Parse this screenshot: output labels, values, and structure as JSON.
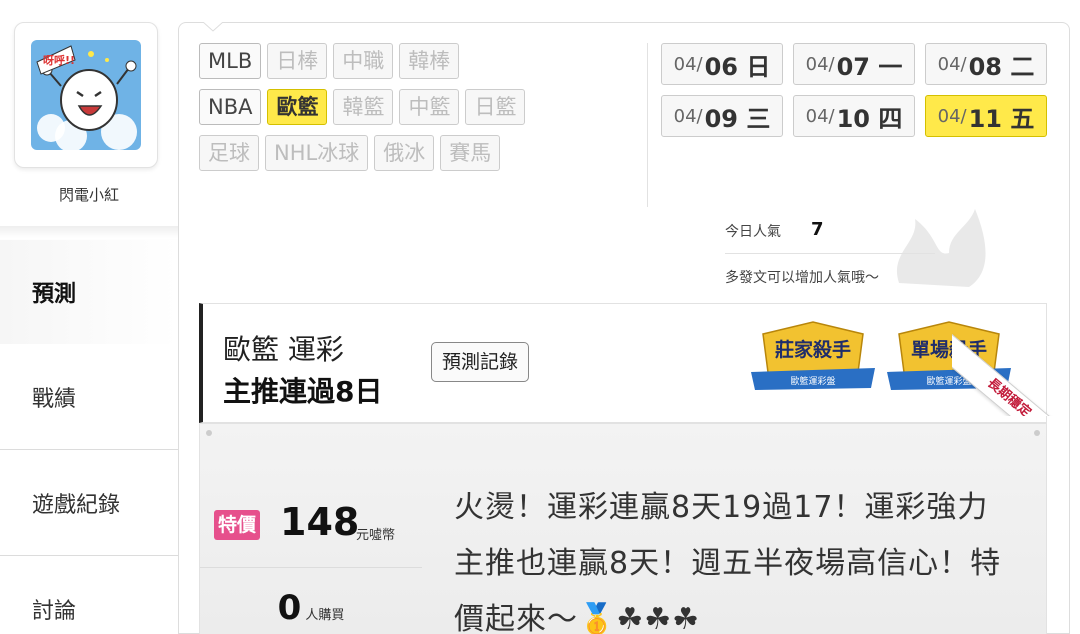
{
  "user": {
    "name": "閃電小紅",
    "avatar_text": "呀呼!!"
  },
  "sidebar": {
    "items": [
      {
        "label": "預測",
        "active": true
      },
      {
        "label": "戰績"
      },
      {
        "label": "遊戲紀錄"
      },
      {
        "label": "討論"
      }
    ]
  },
  "sports": {
    "rows": [
      [
        {
          "label": "MLB",
          "state": "on"
        },
        {
          "label": "日棒",
          "state": "off"
        },
        {
          "label": "中職",
          "state": "off"
        },
        {
          "label": "韓棒",
          "state": "off"
        }
      ],
      [
        {
          "label": "NBA",
          "state": "on"
        },
        {
          "label": "歐籃",
          "state": "selected"
        },
        {
          "label": "韓籃",
          "state": "off"
        },
        {
          "label": "中籃",
          "state": "off"
        },
        {
          "label": "日籃",
          "state": "off"
        }
      ],
      [
        {
          "label": "足球",
          "state": "off"
        },
        {
          "label": "NHL冰球",
          "state": "off"
        },
        {
          "label": "俄冰",
          "state": "off"
        },
        {
          "label": "賽馬",
          "state": "off"
        }
      ]
    ]
  },
  "dates": {
    "rows": [
      [
        {
          "md": "04/",
          "day": "06 日"
        },
        {
          "md": "04/",
          "day": "07 一"
        },
        {
          "md": "04/",
          "day": "08 二"
        }
      ],
      [
        {
          "md": "04/",
          "day": "09 三"
        },
        {
          "md": "04/",
          "day": "10 四"
        },
        {
          "md": "04/",
          "day": "11 五",
          "selected": true
        }
      ]
    ]
  },
  "popularity": {
    "label": "今日人氣",
    "value": "7",
    "tip": "多發文可以增加人氣哦～"
  },
  "package": {
    "title_line1": "歐籃 運彩",
    "title_line2": "主推連過8日",
    "record_button": "預測記錄",
    "badges": [
      {
        "title": "莊家殺手",
        "sub": "歐籃運彩盤"
      },
      {
        "title": "單場殺手",
        "sub": "歐籃運彩盤"
      }
    ],
    "ribbon": "長期穩定",
    "special_tag": "特價",
    "price": "148",
    "price_unit": "元噓幣",
    "buyers": "0",
    "buyers_unit": "人購買",
    "description": "火燙！運彩連贏8天19過17！運彩強力主推也連贏8天！週五半夜場高信心！特價起來～🥇☘☘☘"
  },
  "colors": {
    "accent_yellow": "#ffe94a",
    "special_pink": "#e6508c",
    "badge_blue": "#2a6fc4",
    "badge_gold": "#f2c230"
  }
}
